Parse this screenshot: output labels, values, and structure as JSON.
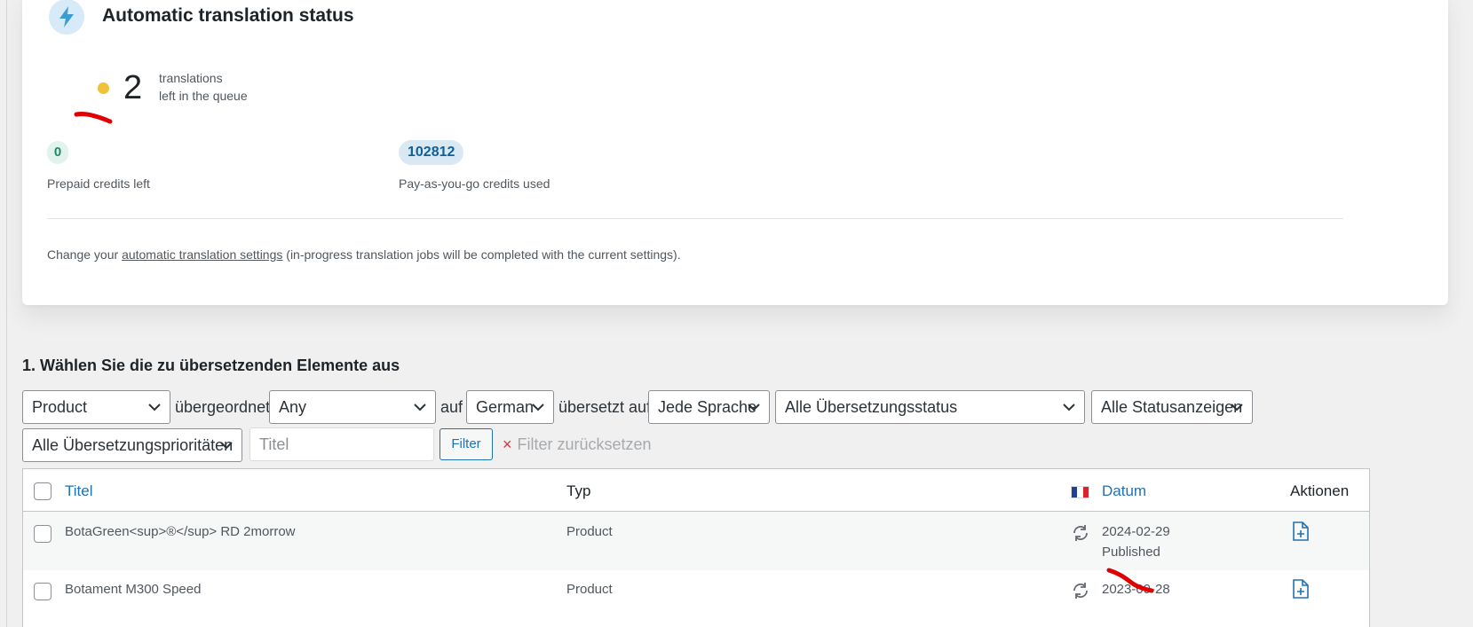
{
  "status_card": {
    "title": "Automatic translation status",
    "queue_count": "2",
    "queue_label_line1": "translations",
    "queue_label_line2": "left in the queue",
    "prepaid_value": "0",
    "prepaid_label": "Prepaid credits left",
    "payg_value": "102812",
    "payg_label": "Pay-as-you-go credits used",
    "settings_prefix": "Change your ",
    "settings_link": "automatic translation settings",
    "settings_suffix": " (in-progress translation jobs will be completed with the current settings)."
  },
  "section": {
    "title": "1. Wählen Sie die zu übersetzenden Elemente aus"
  },
  "filters": {
    "type_select": "Product",
    "parent_label": "übergeordnet",
    "parent_select": "Any",
    "lang_prefix": "auf",
    "lang_select": "German",
    "translated_label": "übersetzt auf",
    "target_select": "Jede Sprache",
    "status_select": "Alle Übersetzungsstatus",
    "display_select": "Alle Statusanzeigen",
    "priority_select": "Alle Übersetzungsprioritäten",
    "title_placeholder": "Titel",
    "filter_button": "Filter",
    "reset_icon": "×",
    "reset_label": "Filter zurücksetzen"
  },
  "table": {
    "columns": {
      "title": "Titel",
      "type": "Typ",
      "date": "Datum",
      "actions": "Aktionen"
    },
    "rows": [
      {
        "title": "BotaGreen<sup>®</sup> RD 2morrow",
        "type": "Product",
        "date": "2024-02-29",
        "status": "Published"
      },
      {
        "title": "Botament M300 Speed",
        "type": "Product",
        "date": "2023-09-28",
        "status": ""
      }
    ]
  },
  "icons": {
    "header_icon": "lightning-bolt-icon",
    "flag": "french-flag-icon",
    "row_status": "refresh-icon",
    "row_action": "add-document-icon"
  },
  "colors": {
    "accent": "#2271b1",
    "queue_dot": "#f0c23a",
    "prepaid_badge": "#1e8a66",
    "annotation_red": "#e00000"
  }
}
